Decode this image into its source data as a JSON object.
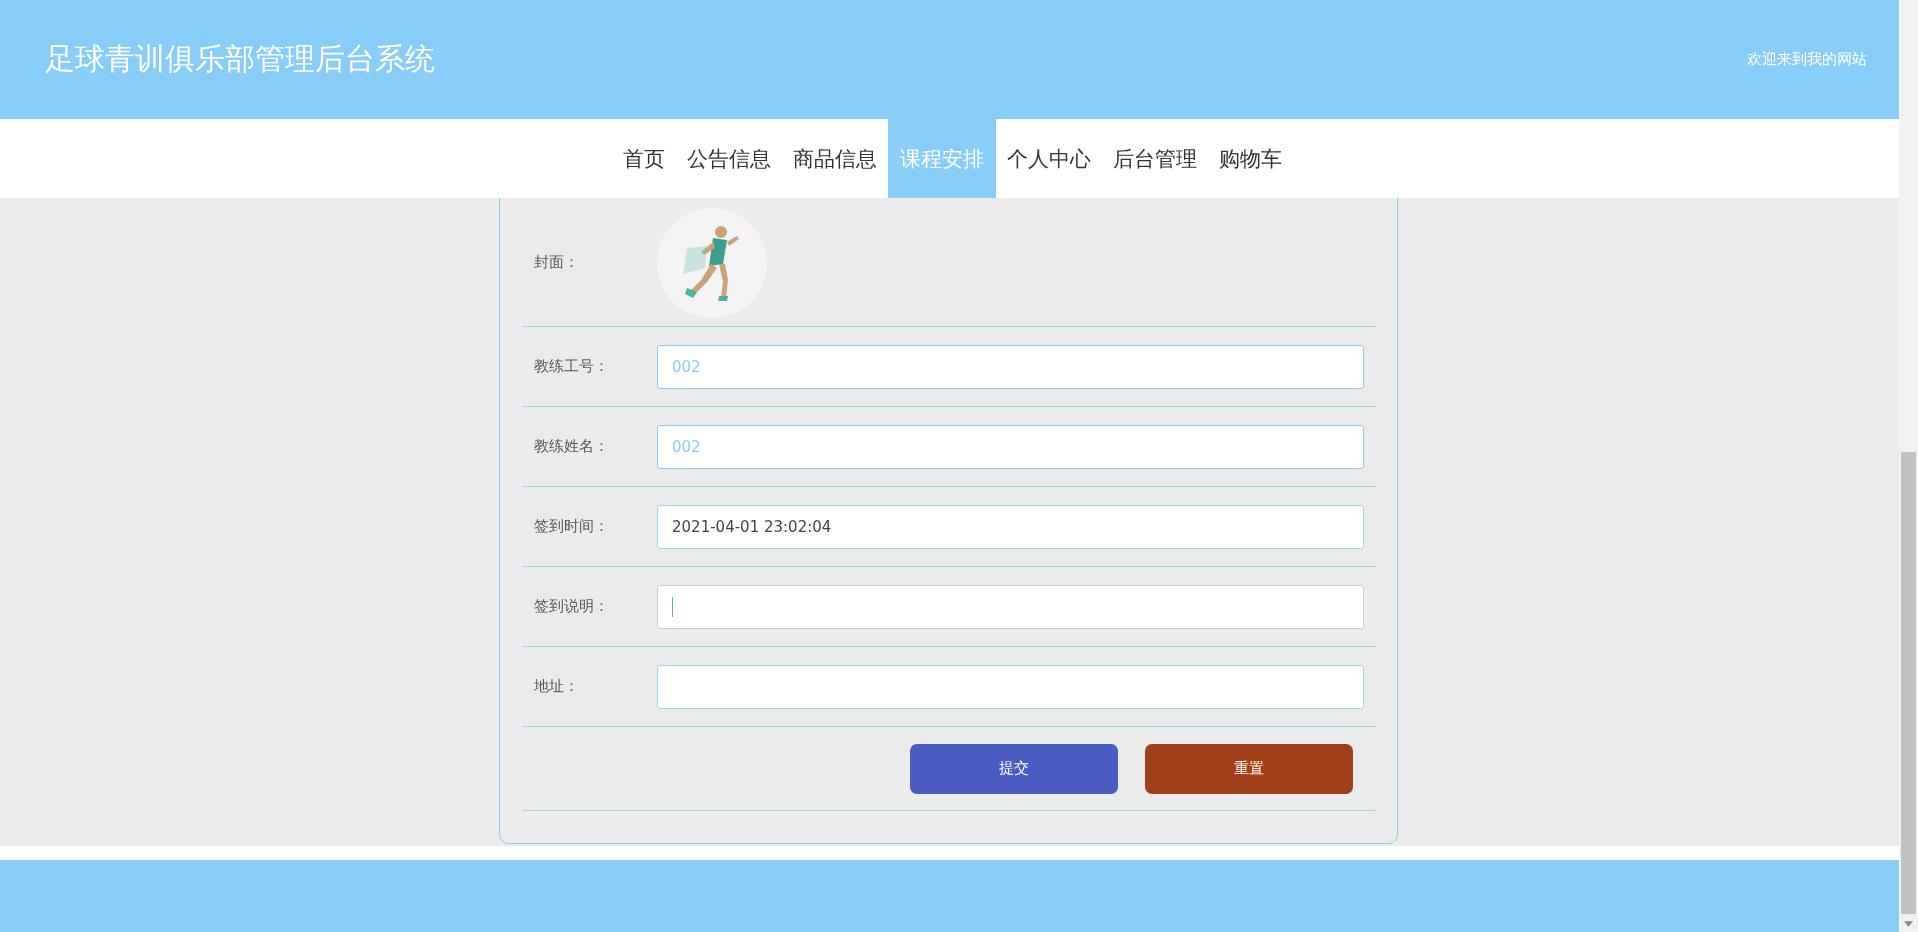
{
  "header": {
    "title": "足球青训俱乐部管理后台系统",
    "welcome": "欢迎来到我的网站"
  },
  "nav": [
    {
      "label": "首页",
      "selected": false
    },
    {
      "label": "公告信息",
      "selected": false
    },
    {
      "label": "商品信息",
      "selected": false
    },
    {
      "label": "课程安排",
      "selected": true
    },
    {
      "label": "个人中心",
      "selected": false
    },
    {
      "label": "后台管理",
      "selected": false
    },
    {
      "label": "购物车",
      "selected": false
    }
  ],
  "form": {
    "cover": {
      "label": "封面：",
      "kind": "picture"
    },
    "fields": [
      {
        "label": "教练工号：",
        "value": "002",
        "readonly": true,
        "focused": false
      },
      {
        "label": "教练姓名：",
        "value": "002",
        "readonly": true,
        "focused": false
      },
      {
        "label": "签到时间：",
        "value": "2021-04-01 23:02:04",
        "readonly": false,
        "focused": false
      },
      {
        "label": "签到说明：",
        "focused": true
      },
      {
        "label": "地址：",
        "focused": false
      }
    ],
    "buttons": [
      {
        "label": "提交",
        "kind": "submit"
      },
      {
        "label": "重置",
        "kind": "reset"
      }
    ]
  }
}
